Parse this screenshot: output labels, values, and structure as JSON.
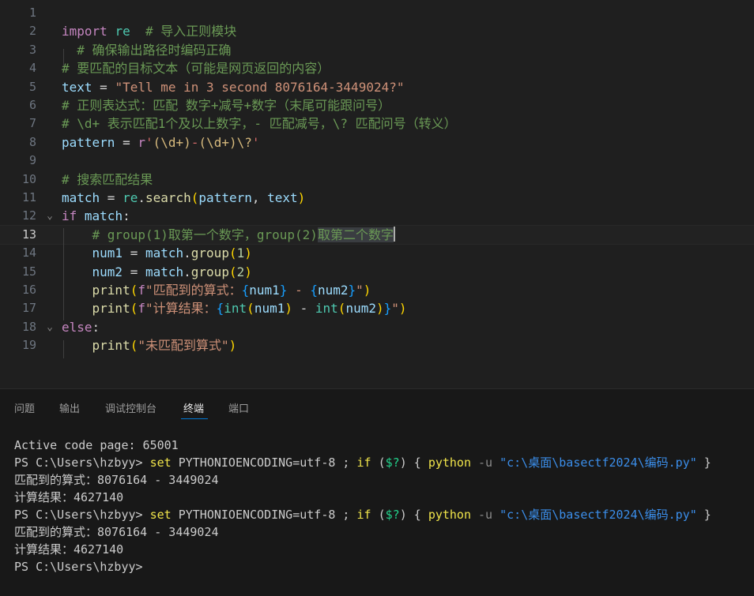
{
  "editor": {
    "current_line": 13,
    "lines": [
      {
        "n": "1",
        "tokens": []
      },
      {
        "n": "2",
        "tokens": [
          {
            "t": "import",
            "c": "kw"
          },
          {
            "t": " ",
            "c": "pl"
          },
          {
            "t": "re",
            "c": "mod"
          },
          {
            "t": "  ",
            "c": "pl"
          },
          {
            "t": "# 导入正则模块",
            "c": "cmt"
          }
        ]
      },
      {
        "n": "3",
        "tokens": [
          {
            "t": "  # 确保输出路径时编码正确",
            "c": "cmt"
          }
        ]
      },
      {
        "n": "4",
        "tokens": [
          {
            "t": "# 要匹配的目标文本（可能是网页返回的内容）",
            "c": "cmt"
          }
        ]
      },
      {
        "n": "5",
        "tokens": [
          {
            "t": "text",
            "c": "var"
          },
          {
            "t": " = ",
            "c": "pl"
          },
          {
            "t": "\"Tell me in 3 second 8076164-3449024?\"",
            "c": "str"
          }
        ]
      },
      {
        "n": "6",
        "tokens": [
          {
            "t": "# 正则表达式：匹配 数字+减号+数字（末尾可能跟问号）",
            "c": "cmt"
          }
        ]
      },
      {
        "n": "7",
        "tokens": [
          {
            "t": "# \\d+ 表示匹配1个及以上数字，- 匹配减号，\\? 匹配问号（转义）",
            "c": "cmt"
          }
        ]
      },
      {
        "n": "8",
        "tokens": [
          {
            "t": "pattern",
            "c": "var"
          },
          {
            "t": " = ",
            "c": "pl"
          },
          {
            "t": "r",
            "c": "kw"
          },
          {
            "t": "'",
            "c": "rx"
          },
          {
            "t": "(",
            "c": "esc"
          },
          {
            "t": "\\d",
            "c": "esc"
          },
          {
            "t": "+",
            "c": "esc"
          },
          {
            "t": ")",
            "c": "esc"
          },
          {
            "t": "-",
            "c": "rx"
          },
          {
            "t": "(",
            "c": "esc"
          },
          {
            "t": "\\d",
            "c": "esc"
          },
          {
            "t": "+",
            "c": "esc"
          },
          {
            "t": ")",
            "c": "esc"
          },
          {
            "t": "\\?",
            "c": "esc"
          },
          {
            "t": "'",
            "c": "rx"
          }
        ]
      },
      {
        "n": "9",
        "tokens": []
      },
      {
        "n": "10",
        "tokens": [
          {
            "t": "# 搜索匹配结果",
            "c": "cmt"
          }
        ]
      },
      {
        "n": "11",
        "tokens": [
          {
            "t": "match",
            "c": "var"
          },
          {
            "t": " = ",
            "c": "pl"
          },
          {
            "t": "re",
            "c": "mod"
          },
          {
            "t": ".",
            "c": "pl"
          },
          {
            "t": "search",
            "c": "fn"
          },
          {
            "t": "(",
            "c": "b1"
          },
          {
            "t": "pattern",
            "c": "var"
          },
          {
            "t": ", ",
            "c": "pl"
          },
          {
            "t": "text",
            "c": "var"
          },
          {
            "t": ")",
            "c": "b1"
          }
        ]
      },
      {
        "n": "12",
        "fold": "⌄",
        "tokens": [
          {
            "t": "if",
            "c": "kw"
          },
          {
            "t": " ",
            "c": "pl"
          },
          {
            "t": "match",
            "c": "var"
          },
          {
            "t": ":",
            "c": "pl"
          }
        ]
      },
      {
        "n": "13",
        "tokens": [
          {
            "t": "    ",
            "c": "pl"
          },
          {
            "t": "# group(1)取第一个数字，group(2)",
            "c": "cmt"
          },
          {
            "t": "取第二个数字",
            "c": "cmt",
            "sel": true
          }
        ]
      },
      {
        "n": "14",
        "tokens": [
          {
            "t": "    ",
            "c": "pl"
          },
          {
            "t": "num1",
            "c": "var"
          },
          {
            "t": " = ",
            "c": "pl"
          },
          {
            "t": "match",
            "c": "var"
          },
          {
            "t": ".",
            "c": "pl"
          },
          {
            "t": "group",
            "c": "fn"
          },
          {
            "t": "(",
            "c": "b1"
          },
          {
            "t": "1",
            "c": "num"
          },
          {
            "t": ")",
            "c": "b1"
          }
        ]
      },
      {
        "n": "15",
        "tokens": [
          {
            "t": "    ",
            "c": "pl"
          },
          {
            "t": "num2",
            "c": "var"
          },
          {
            "t": " = ",
            "c": "pl"
          },
          {
            "t": "match",
            "c": "var"
          },
          {
            "t": ".",
            "c": "pl"
          },
          {
            "t": "group",
            "c": "fn"
          },
          {
            "t": "(",
            "c": "b1"
          },
          {
            "t": "2",
            "c": "num"
          },
          {
            "t": ")",
            "c": "b1"
          }
        ]
      },
      {
        "n": "16",
        "tokens": [
          {
            "t": "    ",
            "c": "pl"
          },
          {
            "t": "print",
            "c": "fn"
          },
          {
            "t": "(",
            "c": "b1"
          },
          {
            "t": "f",
            "c": "kw"
          },
          {
            "t": "\"匹配到的算式：",
            "c": "str"
          },
          {
            "t": "{",
            "c": "b3"
          },
          {
            "t": "num1",
            "c": "var"
          },
          {
            "t": "}",
            "c": "b3"
          },
          {
            "t": " - ",
            "c": "str"
          },
          {
            "t": "{",
            "c": "b3"
          },
          {
            "t": "num2",
            "c": "var"
          },
          {
            "t": "}",
            "c": "b3"
          },
          {
            "t": "\"",
            "c": "str"
          },
          {
            "t": ")",
            "c": "b1"
          }
        ]
      },
      {
        "n": "17",
        "tokens": [
          {
            "t": "    ",
            "c": "pl"
          },
          {
            "t": "print",
            "c": "fn"
          },
          {
            "t": "(",
            "c": "b1"
          },
          {
            "t": "f",
            "c": "kw"
          },
          {
            "t": "\"计算结果：",
            "c": "str"
          },
          {
            "t": "{",
            "c": "b3"
          },
          {
            "t": "int",
            "c": "bi"
          },
          {
            "t": "(",
            "c": "b1"
          },
          {
            "t": "num1",
            "c": "var"
          },
          {
            "t": ")",
            "c": "b1"
          },
          {
            "t": " - ",
            "c": "pl"
          },
          {
            "t": "int",
            "c": "bi"
          },
          {
            "t": "(",
            "c": "b1"
          },
          {
            "t": "num2",
            "c": "var"
          },
          {
            "t": ")",
            "c": "b1"
          },
          {
            "t": "}",
            "c": "b3"
          },
          {
            "t": "\"",
            "c": "str"
          },
          {
            "t": ")",
            "c": "b1"
          }
        ]
      },
      {
        "n": "18",
        "fold": "⌄",
        "tokens": [
          {
            "t": "else",
            "c": "kw"
          },
          {
            "t": ":",
            "c": "pl"
          }
        ]
      },
      {
        "n": "19",
        "tokens": [
          {
            "t": "    ",
            "c": "pl"
          },
          {
            "t": "print",
            "c": "fn"
          },
          {
            "t": "(",
            "c": "b1"
          },
          {
            "t": "\"未匹配到算式\"",
            "c": "str"
          },
          {
            "t": ")",
            "c": "b1"
          }
        ]
      }
    ]
  },
  "panel": {
    "tabs": [
      {
        "label": "问题",
        "name": "tab-problems",
        "active": false
      },
      {
        "label": "输出",
        "name": "tab-output",
        "active": false
      },
      {
        "label": "调试控制台",
        "name": "tab-debug-console",
        "active": false
      },
      {
        "label": "终端",
        "name": "tab-terminal",
        "active": true
      },
      {
        "label": "端口",
        "name": "tab-ports",
        "active": false
      }
    ]
  },
  "terminal": {
    "lines": [
      [
        {
          "t": "Active code page: 65001",
          "c": "t-plain"
        }
      ],
      [
        {
          "t": "PS C:\\Users\\hzbyy> ",
          "c": "t-plain"
        },
        {
          "t": "set",
          "c": "t-cmd"
        },
        {
          "t": " PYTHONIOENCODING=utf-8 ; ",
          "c": "t-plain"
        },
        {
          "t": "if",
          "c": "t-cmd"
        },
        {
          "t": " (",
          "c": "t-plain"
        },
        {
          "t": "$?",
          "c": "t-var"
        },
        {
          "t": ") { ",
          "c": "t-plain"
        },
        {
          "t": "python",
          "c": "t-cmd"
        },
        {
          "t": " -u ",
          "c": "t-param"
        },
        {
          "t": "\"c:\\桌面\\basectf2024\\编码.py\"",
          "c": "t-str"
        },
        {
          "t": " }",
          "c": "t-plain"
        }
      ],
      [
        {
          "t": "匹配到的算式：8076164 - 3449024",
          "c": "t-plain"
        }
      ],
      [
        {
          "t": "计算结果：4627140",
          "c": "t-plain"
        }
      ],
      [
        {
          "t": "PS C:\\Users\\hzbyy> ",
          "c": "t-plain"
        },
        {
          "t": "set",
          "c": "t-cmd"
        },
        {
          "t": " PYTHONIOENCODING=utf-8 ; ",
          "c": "t-plain"
        },
        {
          "t": "if",
          "c": "t-cmd"
        },
        {
          "t": " (",
          "c": "t-plain"
        },
        {
          "t": "$?",
          "c": "t-var"
        },
        {
          "t": ") { ",
          "c": "t-plain"
        },
        {
          "t": "python",
          "c": "t-cmd"
        },
        {
          "t": " -u ",
          "c": "t-param"
        },
        {
          "t": "\"c:\\桌面\\basectf2024\\编码.py\"",
          "c": "t-str"
        },
        {
          "t": " }",
          "c": "t-plain"
        }
      ],
      [
        {
          "t": "匹配到的算式：8076164 - 3449024",
          "c": "t-plain"
        }
      ],
      [
        {
          "t": "计算结果：4627140",
          "c": "t-plain"
        }
      ],
      [
        {
          "t": "PS C:\\Users\\hzbyy>",
          "c": "t-plain"
        }
      ]
    ]
  }
}
